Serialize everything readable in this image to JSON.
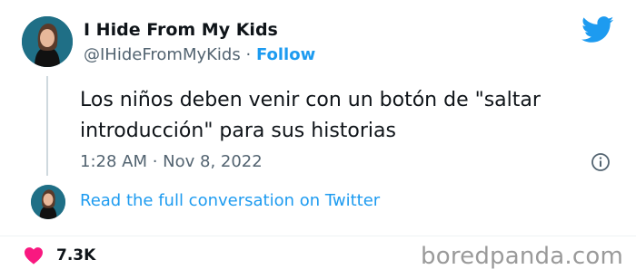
{
  "tweet": {
    "display_name": "I Hide From My Kids",
    "handle": "@IHideFromMyKids",
    "separator": "·",
    "follow_label": "Follow",
    "text": "Los niños deben venir con un botón de \"saltar introducción\" para sus historias",
    "timestamp": "1:28 AM · Nov 8, 2022",
    "read_more": "Read the full conversation on Twitter",
    "likes": "7.3K"
  },
  "watermark": "boredpanda.com",
  "colors": {
    "accent": "#1d9bf0",
    "heart": "#f91880",
    "secondary_text": "#536471"
  },
  "icons": [
    "twitter-bird-icon",
    "info-icon",
    "heart-icon"
  ]
}
